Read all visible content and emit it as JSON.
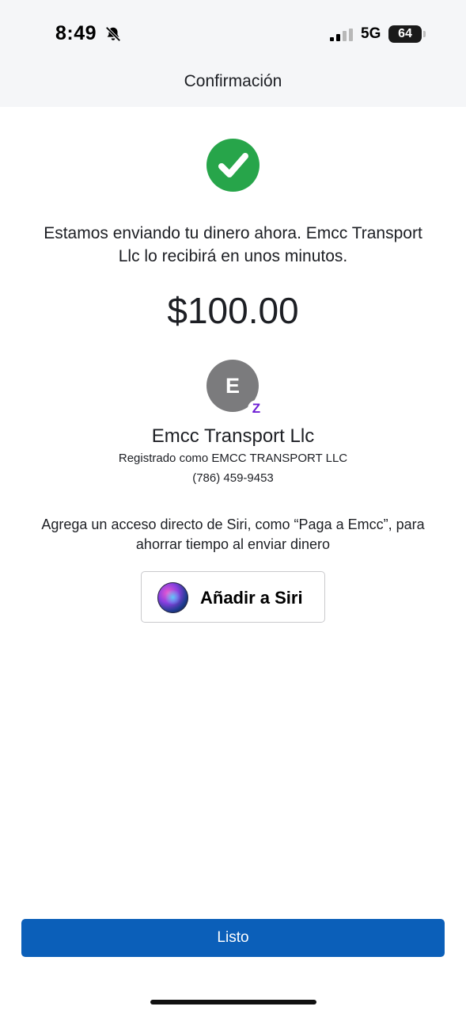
{
  "status_bar": {
    "time": "8:49",
    "network": "5G",
    "battery": "64",
    "icons": [
      "bell-slash-icon",
      "signal-icon",
      "battery-icon"
    ]
  },
  "nav": {
    "title": "Confirmación"
  },
  "confirmation": {
    "icon": "checkmark-circle-icon",
    "message": "Estamos enviando tu dinero ahora. Emcc Transport Llc lo recibirá en unos minutos.",
    "amount": "$100.00"
  },
  "recipient": {
    "initial": "E",
    "badge": "Z",
    "name": "Emcc Transport Llc",
    "registered_as": "Registrado como EMCC TRANSPORT LLC",
    "phone": "(786) 459-9453"
  },
  "siri": {
    "prompt": "Agrega un acceso directo de Siri, como “Paga a Emcc”, para ahorrar tiempo al enviar dinero",
    "button_label": "Añadir a Siri",
    "icon": "siri-icon"
  },
  "footer": {
    "done_label": "Listo"
  },
  "colors": {
    "header_bg": "#f5f6f8",
    "success": "#27a54a",
    "primary": "#0b5fb9",
    "avatar": "#7b7b7d",
    "zelle": "#6d1ed4"
  }
}
